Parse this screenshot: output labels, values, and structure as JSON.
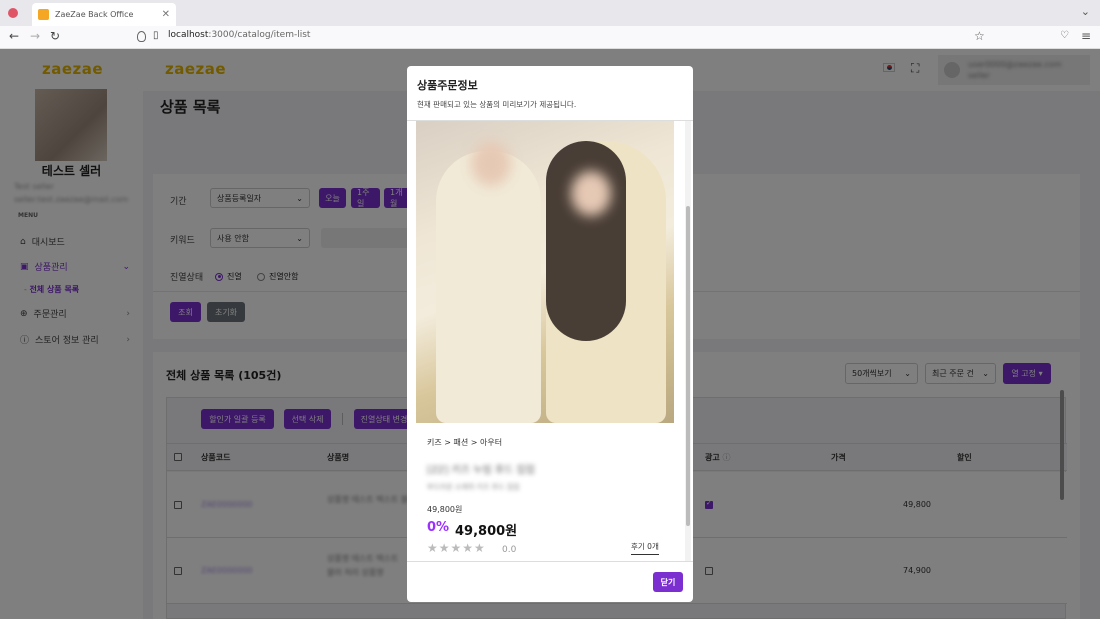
{
  "browser": {
    "tab_title": "ZaeZae Back Office",
    "url_host": "localhost",
    "url_path": ":3000/catalog/item-list"
  },
  "sidebar": {
    "logo": "zaezae",
    "seller_name": "테스트 셀러",
    "seller_line1": "Test seller",
    "seller_line2": "seller.test.zaezae@mail.com",
    "menu_label": "MENU",
    "items": [
      {
        "label": "대시보드",
        "icon": "home-icon"
      },
      {
        "label": "상품관리",
        "icon": "gift-icon"
      },
      {
        "label": "주문관리",
        "icon": "cart-icon"
      },
      {
        "label": "스토어 정보 관리",
        "icon": "info-icon"
      }
    ],
    "sub_item": "전체 상품 목록"
  },
  "header": {
    "logo": "zaezae",
    "user_email": "user0000@zaezae.com",
    "user_name": "seller"
  },
  "page": {
    "title": "상품 목록"
  },
  "filters": {
    "period_label": "기간",
    "period_select": "상품등록일자",
    "btn_today": "오늘",
    "btn_week": "1주일",
    "btn_month": "1개월",
    "keyword_label": "키워드",
    "keyword_select": "사용 안함",
    "display_label": "진열상태",
    "display_on": "진열",
    "display_off": "진열안함",
    "search_btn": "조회",
    "reset_btn": "초기화"
  },
  "list": {
    "title": "전체 상품 목록 (105건)",
    "page_size": "50개씩보기",
    "sort": "최근 주문 건",
    "column_fix": "열 고정",
    "btn_discount": "할인가 일괄 등록",
    "btn_delete": "선택 삭제",
    "btn_display": "진열상태 변경",
    "columns": [
      "상품코드",
      "상품명",
      "광고",
      "가격",
      "할인"
    ],
    "rows": [
      {
        "code": "ZAE0000000",
        "name": "상품명 테스트 텍스트 블러",
        "name2": "",
        "ad": true,
        "price": "49,800"
      },
      {
        "code": "ZAE0000000",
        "name": "상품명 테스트 텍스트",
        "name2": "블러 처리 상품명",
        "ad": false,
        "price": "74,900"
      }
    ]
  },
  "modal": {
    "title": "상품주문정보",
    "subtitle": "현재 판매되고 있는 상품의 미리보기가 제공됩니다.",
    "category": "키즈 > 패션 > 아우터",
    "product_name": "[ZZ] 키즈 누빔 후드 집업",
    "product_desc": "부드러운 소재의 키즈 후드 집업",
    "original_price": "49,800원",
    "discount_rate": "0%",
    "price": "49,800원",
    "stars": "★★★★★",
    "score": "0.0",
    "review": "후기 0개",
    "close_btn": "닫기"
  },
  "colors": {
    "primary": "#7b2fd1",
    "logo": "#e3b500"
  }
}
